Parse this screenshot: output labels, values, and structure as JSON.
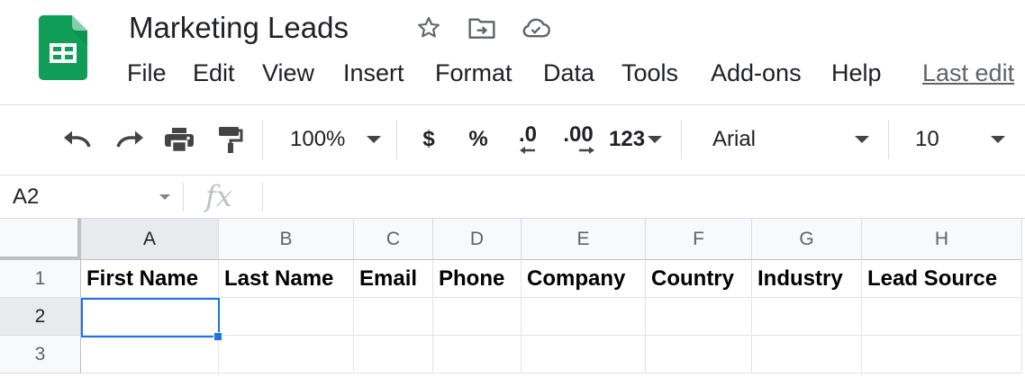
{
  "document": {
    "title": "Marketing Leads",
    "last_edit": "Last edit"
  },
  "menu": [
    "File",
    "Edit",
    "View",
    "Insert",
    "Format",
    "Data",
    "Tools",
    "Add-ons",
    "Help"
  ],
  "toolbar": {
    "zoom": "100%",
    "currency": "$",
    "percent": "%",
    "decrease_decimal": ".0",
    "increase_decimal": ".00",
    "more_formats": "123",
    "font": "Arial",
    "font_size": "10"
  },
  "formula_bar": {
    "name_box": "A2",
    "fx_label": "fx",
    "value": ""
  },
  "sheet": {
    "selected_cell": "A2",
    "columns": [
      "A",
      "B",
      "C",
      "D",
      "E",
      "F",
      "G",
      "H"
    ],
    "rows": [
      "1",
      "2",
      "3"
    ],
    "cells": [
      [
        "First Name",
        "Last Name",
        "Email",
        "Phone",
        "Company",
        "Country",
        "Industry",
        "Lead Source"
      ],
      [
        "",
        "",
        "",
        "",
        "",
        "",
        "",
        ""
      ],
      [
        "",
        "",
        "",
        "",
        "",
        "",
        "",
        ""
      ]
    ]
  },
  "colors": {
    "accent": "#1a73e8",
    "sheets_green": "#0f9d58"
  },
  "icons": [
    "sheets-logo-icon",
    "star-icon",
    "move-to-folder-icon",
    "cloud-saved-icon",
    "undo-icon",
    "redo-icon",
    "print-icon",
    "paint-format-icon",
    "chevron-down-icon"
  ]
}
